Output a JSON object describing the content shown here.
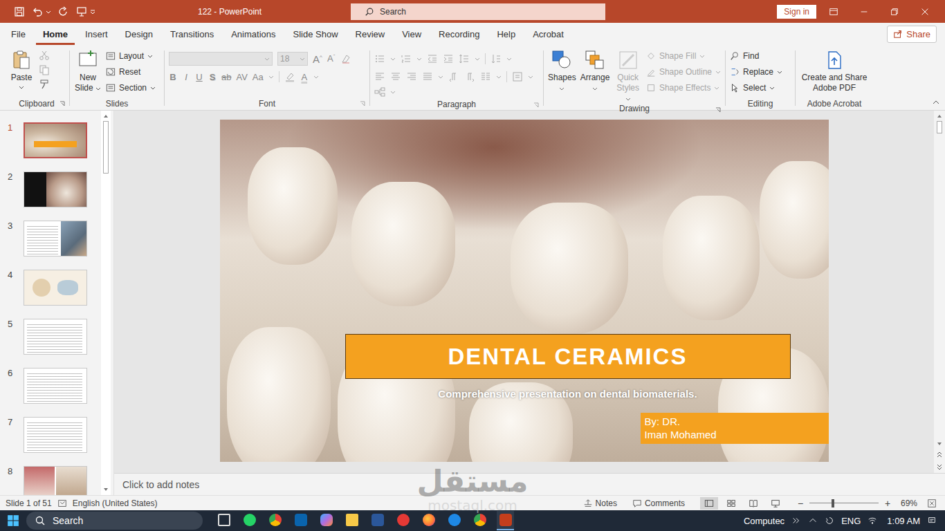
{
  "window": {
    "title": "122  -  PowerPoint",
    "search_placeholder": "Search",
    "sign_in": "Sign in"
  },
  "ribbon_tabs": [
    {
      "label": "File",
      "selected": false
    },
    {
      "label": "Home",
      "selected": true
    },
    {
      "label": "Insert",
      "selected": false
    },
    {
      "label": "Design",
      "selected": false
    },
    {
      "label": "Transitions",
      "selected": false
    },
    {
      "label": "Animations",
      "selected": false
    },
    {
      "label": "Slide Show",
      "selected": false
    },
    {
      "label": "Review",
      "selected": false
    },
    {
      "label": "View",
      "selected": false
    },
    {
      "label": "Recording",
      "selected": false
    },
    {
      "label": "Help",
      "selected": false
    },
    {
      "label": "Acrobat",
      "selected": false
    }
  ],
  "share": "Share",
  "clipboard": {
    "label": "Clipboard",
    "paste": "Paste"
  },
  "slides": {
    "label": "Slides",
    "new_slide": "New Slide",
    "items": [
      "Layout",
      "Reset",
      "Section"
    ]
  },
  "font": {
    "label": "Font",
    "size": "18",
    "disabled": true,
    "format_buttons": [
      "B",
      "I",
      "U",
      "S",
      "ab",
      "AV",
      "Aa"
    ],
    "grow": "A",
    "shrink": "A",
    "color": "A"
  },
  "paragraph": {
    "label": "Paragraph"
  },
  "drawing": {
    "label": "Drawing",
    "big": [
      {
        "label": "Shapes",
        "disabled": false
      },
      {
        "label": "Arrange",
        "disabled": false
      },
      {
        "label": "Quick Styles",
        "disabled": true
      }
    ],
    "small": [
      {
        "label": "Shape Fill",
        "disabled": true
      },
      {
        "label": "Shape Outline",
        "disabled": true
      },
      {
        "label": "Shape Effects",
        "disabled": true
      }
    ]
  },
  "editing": {
    "label": "Editing",
    "items": [
      "Find",
      "Replace",
      "Select"
    ]
  },
  "acrobat": {
    "label": "Adobe Acrobat",
    "button": "Create and Share Adobe PDF"
  },
  "thumbnails": [
    {
      "number": "1",
      "kind": "title-photo",
      "selected": true
    },
    {
      "number": "2",
      "kind": "dark-photo",
      "selected": false
    },
    {
      "number": "3",
      "kind": "text-photo",
      "selected": false
    },
    {
      "number": "4",
      "kind": "diagram",
      "selected": false
    },
    {
      "number": "5",
      "kind": "text",
      "selected": false
    },
    {
      "number": "6",
      "kind": "text",
      "selected": false
    },
    {
      "number": "7",
      "kind": "text",
      "selected": false
    },
    {
      "number": "8",
      "kind": "photo-grid",
      "selected": false
    }
  ],
  "slide": {
    "title": "DENTAL CERAMICS",
    "subtitle": "Comprehensive presentation on dental biomaterials.",
    "author": [
      "By: DR.",
      "Iman Mohamed"
    ]
  },
  "notes_placeholder": "Click to add notes",
  "status_bar": {
    "slide": "Slide 1 of 51",
    "language": "English (United States)",
    "notes": "Notes",
    "comments": "Comments",
    "views": [
      {
        "kind": "normal",
        "selected": true
      },
      {
        "kind": "sorter",
        "selected": false
      },
      {
        "kind": "reading",
        "selected": false
      },
      {
        "kind": "slideshow",
        "selected": false
      }
    ],
    "zoom_out": "−",
    "zoom_in": "+",
    "zoom_level": 0.34,
    "zoom": "69%"
  },
  "taskbar": {
    "search_placeholder": "Search",
    "tray_label": "Computec",
    "language": "ENG",
    "time": "1:09 AM",
    "apps": [
      {
        "kind": "task-view",
        "active": false
      },
      {
        "kind": "whatsapp",
        "active": false
      },
      {
        "kind": "chrome",
        "active": false
      },
      {
        "kind": "outlook",
        "active": false
      },
      {
        "kind": "copilot",
        "active": false
      },
      {
        "kind": "explorer",
        "active": false
      },
      {
        "kind": "word",
        "active": false
      },
      {
        "kind": "red-app",
        "active": false
      },
      {
        "kind": "firefox",
        "active": false
      },
      {
        "kind": "blue-app",
        "active": false
      },
      {
        "kind": "chrome",
        "active": false
      },
      {
        "kind": "powerpoint",
        "active": true
      }
    ]
  },
  "watermark": {
    "arabic": "مستقل",
    "latin": "mostaql.com"
  }
}
